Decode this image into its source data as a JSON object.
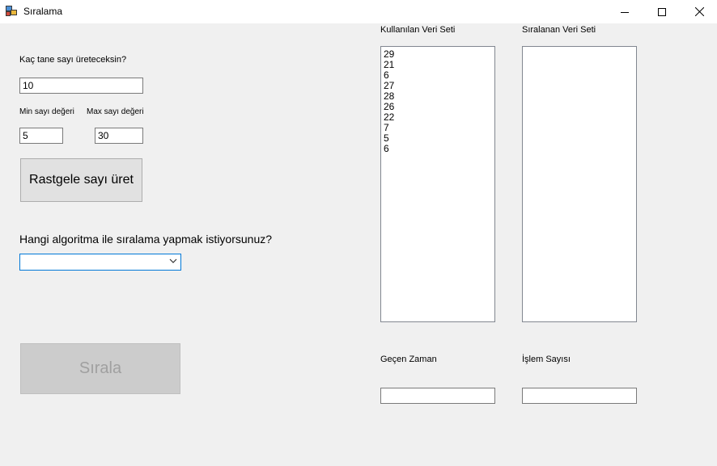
{
  "window": {
    "title": "Sıralama",
    "minimize_glyph": "—",
    "maximize_glyph": "☐",
    "close_glyph": "✕"
  },
  "left": {
    "count_label": "Kaç tane sayı üreteceksin?",
    "count_value": "10",
    "min_label": "Min sayı değeri",
    "min_value": "5",
    "max_label": "Max sayı değeri",
    "max_value": "30",
    "generate_button": "Rastgele sayı üret",
    "algorithm_label": "Hangi algoritma ile sıralama yapmak istiyorsunuz?",
    "algorithm_selected": "",
    "sort_button": "Sırala"
  },
  "right": {
    "used_set_label": "Kullanılan Veri Seti",
    "used_set_items": [
      "29",
      "21",
      "6",
      "27",
      "28",
      "26",
      "22",
      "7",
      "5",
      "6"
    ],
    "sorted_set_label": "Sıralanan Veri Seti",
    "sorted_set_items": [],
    "elapsed_label": "Geçen Zaman",
    "elapsed_value": "",
    "ops_label": "İşlem Sayısı",
    "ops_value": ""
  },
  "icons": {
    "app": "app-icon",
    "dropdown": "chevron-down-icon"
  },
  "colors": {
    "background": "#f0f0f0",
    "titlebar": "#ffffff",
    "focus_border": "#0078d7",
    "disabled_text": "#a0a0a0"
  }
}
